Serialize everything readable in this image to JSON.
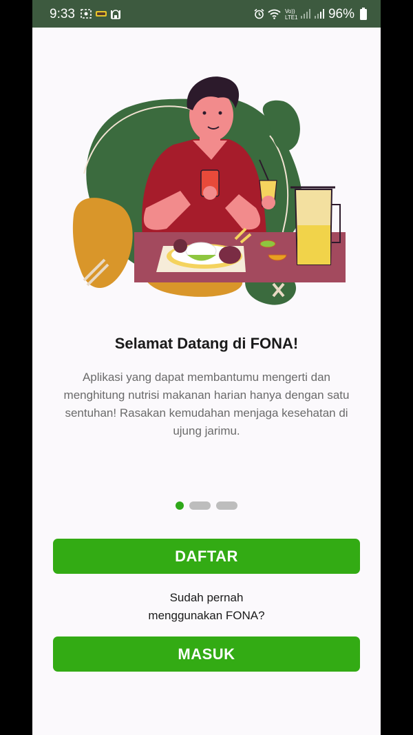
{
  "status_bar": {
    "time": "9:33",
    "battery_percent": "96%",
    "left_icons": [
      "screen-record-icon",
      "app-notification-icon",
      "mosque-icon"
    ],
    "right_icons": [
      "alarm-icon",
      "wifi-icon",
      "volte-icon",
      "signal-icon",
      "signal-icon-2",
      "battery-icon"
    ],
    "volte_label_top": "Vo))",
    "volte_label_bottom": "LTE1"
  },
  "onboarding": {
    "title": "Selamat Datang di FONA!",
    "description": "Aplikasi yang dapat membantumu mengerti dan menghitung nutrisi makanan harian hanya dengan satu sentuhan! Rasakan kemudahan menjaga kesehatan di ujung jarimu.",
    "page_indicator": {
      "current": 1,
      "total": 3
    }
  },
  "actions": {
    "register_label": "DAFTAR",
    "login_prompt_line1": "Sudah pernah",
    "login_prompt_line2": "menggunakan FONA?",
    "login_label": "MASUK"
  },
  "colors": {
    "status_bar": "#3d5a3f",
    "primary_button": "#33ab14",
    "active_dot": "#2fa81a",
    "inactive_dot": "#bdbdbd",
    "blob_green": "#3b6b3e",
    "blob_orange": "#d9962a",
    "table": "#a34a5e"
  }
}
